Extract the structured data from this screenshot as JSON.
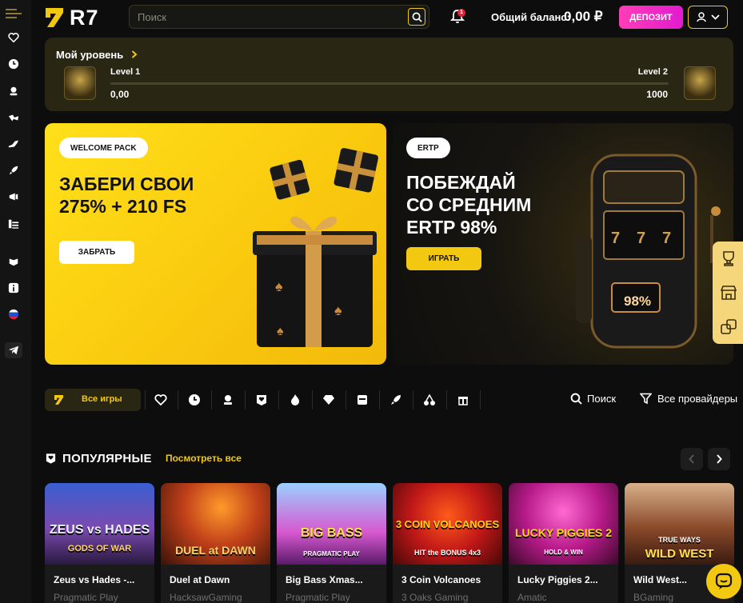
{
  "header": {
    "logo_text": "R7",
    "search_placeholder": "Поиск",
    "notification_count": "1",
    "balance_label": "Общий баланс:",
    "balance_value": "0,00 ₽",
    "deposit_label": "ДЕПОЗИТ"
  },
  "level": {
    "title": "Мой уровень",
    "current_name": "Level 1",
    "current_value": "0,00",
    "next_name": "Level 2",
    "next_value": "1000",
    "progress": 0.0
  },
  "banners": [
    {
      "tag": "WELCOME PACK",
      "title_line1": "ЗАБЕРИ СВОИ",
      "title_line2": "275% + 210 FS",
      "button": "ЗАБРАТЬ"
    },
    {
      "tag": "ERTP",
      "title_line1": "ПОБЕЖДАЙ",
      "title_line2": "СО СРЕДНИМ",
      "title_line3": "ERTP 98%",
      "button": "ИГРАТЬ",
      "slot_value": "98%"
    }
  ],
  "filters": {
    "all_games": "Все игры",
    "search": "Поиск",
    "providers": "Все провайдеры"
  },
  "popular": {
    "title": "ПОПУЛЯРНЫЕ",
    "view_all": "Посмотреть все",
    "games": [
      {
        "name": "Zeus vs Hades -...",
        "provider": "Pragmatic Play",
        "art": "ZEUS vs HADES",
        "art_sub": "GODS OF WAR"
      },
      {
        "name": "Duel at Dawn",
        "provider": "HacksawGaming",
        "art": "DUEL at DAWN",
        "art_sub": ""
      },
      {
        "name": "Big Bass Xmas...",
        "provider": "Pragmatic Play",
        "art": "BIG BASS",
        "art_sub": "PRAGMATIC PLAY"
      },
      {
        "name": "3 Coin Volcanoes",
        "provider": "3 Oaks Gaming",
        "art": "3 COIN VOLCANOES",
        "art_sub": "HIT the BONUS 4x3"
      },
      {
        "name": "Lucky Piggies 2...",
        "provider": "Amatic",
        "art": "LUCKY PIGGIES 2",
        "art_sub": "HOLD & WIN"
      },
      {
        "name": "Wild West...",
        "provider": "BGaming",
        "art": "WILD WEST",
        "art_sub": "TRUE WAYS"
      }
    ]
  },
  "colors": {
    "accent": "#f2c811",
    "deposit": "#ff3db8",
    "background": "#0d0d0d",
    "sidebar": "#141414"
  }
}
